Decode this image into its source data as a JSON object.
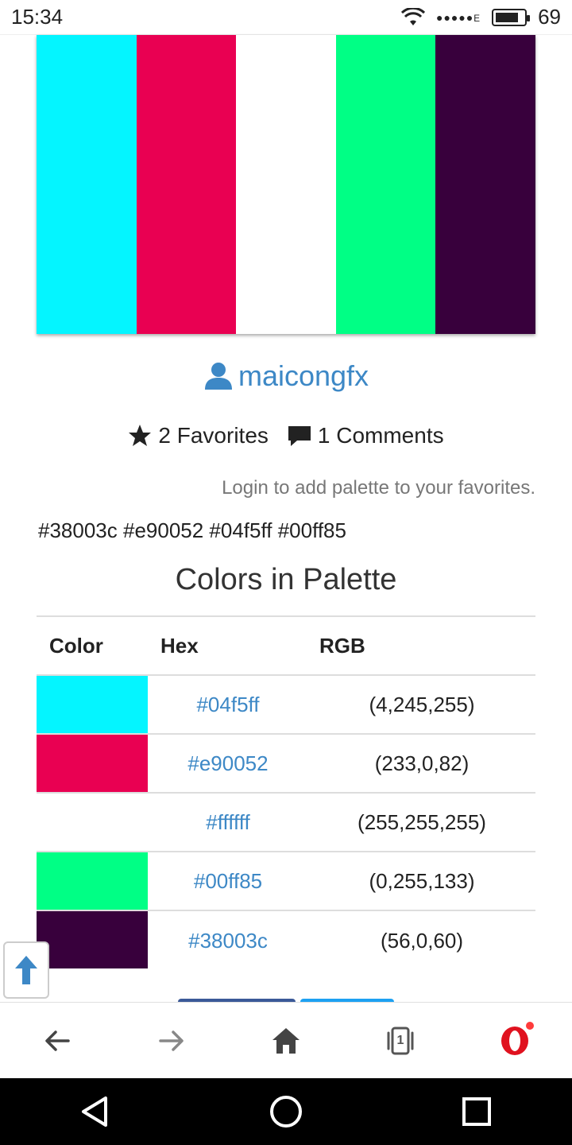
{
  "status_bar": {
    "time": "15:34",
    "network_type": "E",
    "battery_level": "69"
  },
  "palette": {
    "colors": [
      "#04f5ff",
      "#e90052",
      "#ffffff",
      "#00ff85",
      "#38003c"
    ]
  },
  "author": {
    "username": "maicongfx"
  },
  "stats": {
    "favorites_label": "2 Favorites",
    "comments_label": "1 Comments"
  },
  "login_note": "Login to add palette to your favorites.",
  "hex_list": "#38003c #e90052 #04f5ff #00ff85",
  "section_title": "Colors in Palette",
  "table": {
    "headers": {
      "color": "Color",
      "hex": "Hex",
      "rgb": "RGB"
    },
    "rows": [
      {
        "swatch": "#04f5ff",
        "hex": "#04f5ff",
        "rgb": "(4,245,255)"
      },
      {
        "swatch": "#e90052",
        "hex": "#e90052",
        "rgb": "(233,0,82)"
      },
      {
        "swatch": "#ffffff",
        "hex": "#ffffff",
        "rgb": "(255,255,255)"
      },
      {
        "swatch": "#00ff85",
        "hex": "#00ff85",
        "rgb": "(0,255,133)"
      },
      {
        "swatch": "#38003c",
        "hex": "#38003c",
        "rgb": "(56,0,60)"
      }
    ]
  },
  "browser_toolbar": {
    "tab_count": "1",
    "icons": [
      "back-arrow-icon",
      "forward-arrow-icon",
      "home-icon",
      "tabs-icon",
      "opera-icon"
    ]
  },
  "theme": {
    "link_color": "#3d88c6",
    "opera_red": "#e0121f"
  }
}
